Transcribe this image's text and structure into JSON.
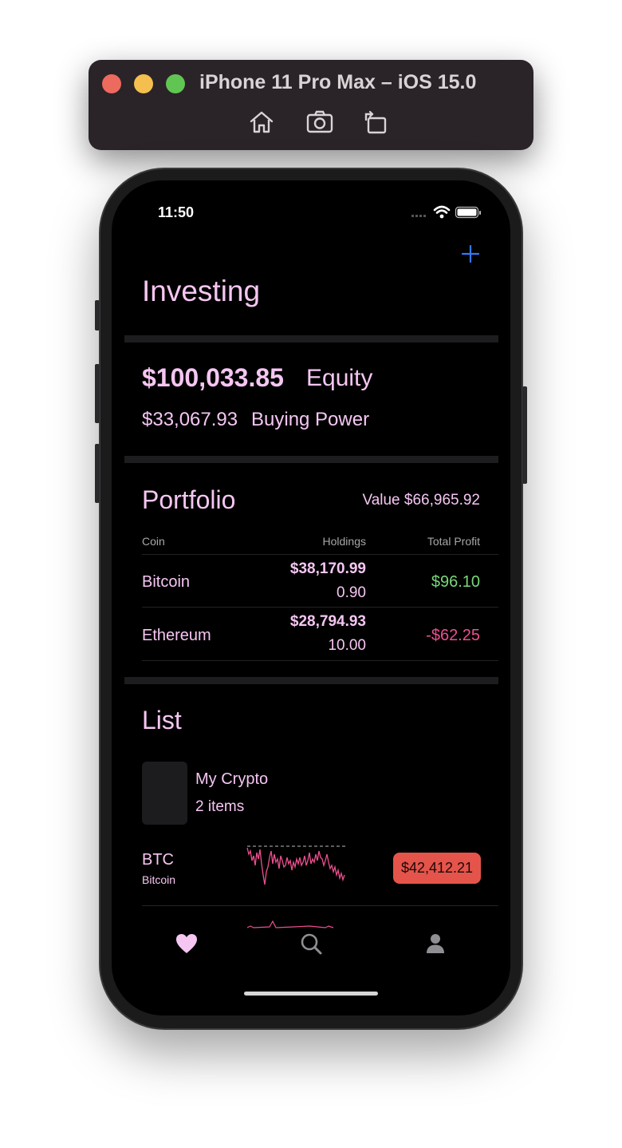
{
  "simulator": {
    "title": "iPhone 11 Pro Max – iOS 15.0",
    "tools": [
      "home-icon",
      "screenshot-icon",
      "rotate-icon"
    ]
  },
  "status_bar": {
    "time": "11:50"
  },
  "header": {
    "title": "Investing",
    "add_icon": "plus-icon"
  },
  "account": {
    "equity_value": "$100,033.85",
    "equity_label": "Equity",
    "buying_power_value": "$33,067.93",
    "buying_power_label": "Buying Power"
  },
  "portfolio": {
    "title": "Portfolio",
    "value_text": "Value $66,965.92",
    "columns": [
      "Coin",
      "Holdings",
      "Total Profit"
    ],
    "rows": [
      {
        "coin": "Bitcoin",
        "holdings_value": "$38,170.99",
        "holdings_qty": "0.90",
        "profit": "$96.10"
      },
      {
        "coin": "Ethereum",
        "holdings_value": "$28,794.93",
        "holdings_qty": "10.00",
        "profit": "-$62.25"
      }
    ]
  },
  "list": {
    "title": "List",
    "name": "My Crypto",
    "count": "2 items",
    "tickers": [
      {
        "symbol": "BTC",
        "name": "Bitcoin",
        "price": "$42,412.21"
      }
    ]
  },
  "tabs": [
    "heart-icon",
    "search-icon",
    "person-icon"
  ],
  "colors": {
    "accent_pink": "#f5c6f2",
    "profit_green": "#7ad77a",
    "loss_pink": "#ec4f8f",
    "price_badge_red": "#e5544a",
    "link_blue": "#3478f6"
  }
}
